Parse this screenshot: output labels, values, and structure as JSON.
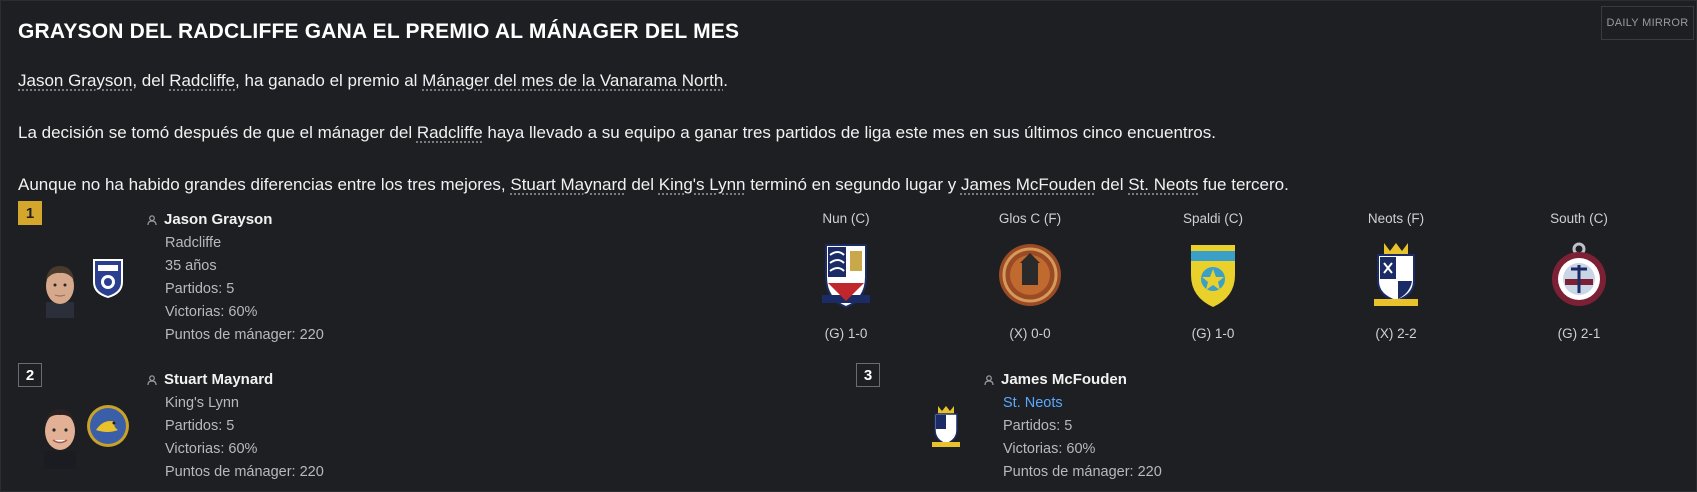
{
  "article": {
    "headline": "GRAYSON DEL RADCLIFFE GANA EL PREMIO AL MÁNAGER DEL MES",
    "source": "DAILY MIRROR",
    "p1": {
      "a": "Jason Grayson",
      "b": ", del ",
      "c": "Radcliffe",
      "d": ", ha ganado el premio al ",
      "e": "Mánager del mes de la Vanarama North",
      "f": "."
    },
    "p2": {
      "a": "La decisión se tomó después de que el mánager del ",
      "b": "Radcliffe",
      "c": " haya llevado a su equipo a ganar tres partidos de liga este mes en sus últimos cinco encuentros."
    },
    "p3": {
      "a": "Aunque no ha habido grandes diferencias entre los tres mejores, ",
      "b": "Stuart Maynard",
      "c": " del ",
      "d": "King's Lynn",
      "e": " terminó en segundo lugar y ",
      "f": "James McFouden",
      "g": " del ",
      "h": "St. Neots",
      "i": " fue tercero."
    }
  },
  "winners": [
    {
      "rank": "1",
      "name": "Jason Grayson",
      "club": "Radcliffe",
      "age": "35 años",
      "matches": "Partidos: 5",
      "wins": "Victorias: 60%",
      "points": "Puntos de mánager: 220"
    },
    {
      "rank": "2",
      "name": "Stuart Maynard",
      "club": "King's Lynn",
      "matches": "Partidos: 5",
      "wins": "Victorias: 60%",
      "points": "Puntos de mánager: 220"
    },
    {
      "rank": "3",
      "name": "James McFouden",
      "club": "St. Neots",
      "matches": "Partidos: 5",
      "wins": "Victorias: 60%",
      "points": "Puntos de mánager: 220"
    }
  ],
  "fixtures": [
    {
      "opponent": "Nun (C)",
      "result": "(G) 1-0",
      "crest_icon": "nuneaton-crest-icon"
    },
    {
      "opponent": "Glos C (F)",
      "result": "(X) 0-0",
      "crest_icon": "gloucester-crest-icon"
    },
    {
      "opponent": "Spaldi (C)",
      "result": "(G) 1-0",
      "crest_icon": "spalding-crest-icon"
    },
    {
      "opponent": "Neots (F)",
      "result": "(X) 2-2",
      "crest_icon": "st-neots-crest-icon"
    },
    {
      "opponent": "South (C)",
      "result": "(G) 2-1",
      "crest_icon": "south-shields-crest-icon"
    }
  ],
  "colors": {
    "background": "#1e1f22",
    "gold_rank": "#d4a72c",
    "link_blue": "#5aa7ff"
  }
}
